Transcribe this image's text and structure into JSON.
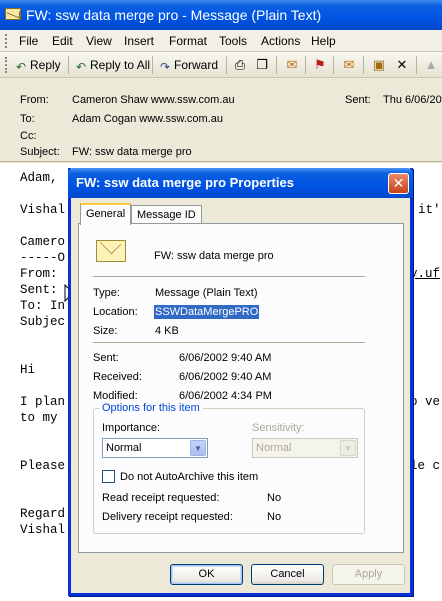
{
  "window": {
    "title": "FW: ssw data merge pro - Message (Plain Text)"
  },
  "menu": {
    "items": [
      "File",
      "Edit",
      "View",
      "Insert",
      "Format",
      "Tools",
      "Actions",
      "Help"
    ]
  },
  "toolbar": {
    "reply": "Reply",
    "reply_all": "Reply to All",
    "forward": "Forward"
  },
  "headers": {
    "from_label": "From:",
    "from_value": "Cameron Shaw  www.ssw.com.au",
    "sent_label": "Sent:",
    "sent_value": "Thu 6/06/20",
    "to_label": "To:",
    "to_value": "Adam Cogan  www.ssw.com.au",
    "cc_label": "Cc:",
    "cc_value": "",
    "subject_label": "Subject:",
    "subject_value": "FW: ssw data merge pro"
  },
  "body": {
    "lines_left": [
      "Adam,",
      "Vishal",
      "Camero",
      "-----O",
      "From:",
      "Sent:",
      "To: In",
      "Subjec",
      "Hi",
      "I plan",
      "to my ",
      "Please",
      "Regard",
      "Vishal"
    ],
    "lines_right": [
      "it'",
      "y.uf",
      "o ve",
      "le c"
    ]
  },
  "dialog": {
    "title": "FW: ssw data merge pro Properties",
    "close": "✕",
    "tabs": [
      "General",
      "Message ID"
    ],
    "item_name": "FW: ssw data merge pro",
    "type_label": "Type:",
    "type_value": "Message  (Plain Text)",
    "location_label": "Location:",
    "location_value": "SSWDataMergePRO",
    "size_label": "Size:",
    "size_value": "4 KB",
    "sent_label": "Sent:",
    "sent_value": "6/06/2002 9:40 AM",
    "received_label": "Received:",
    "received_value": "6/06/2002 9:40 AM",
    "modified_label": "Modified:",
    "modified_value": "6/06/2002 4:34 PM",
    "options_legend": "Options for this item",
    "importance_label": "Importance:",
    "importance_value": "Normal",
    "sensitivity_label": "Sensitivity:",
    "sensitivity_value": "Normal",
    "autoarchive_label": "Do not AutoArchive this item",
    "read_receipt_label": "Read receipt requested:",
    "read_receipt_value": "No",
    "delivery_receipt_label": "Delivery receipt requested:",
    "delivery_receipt_value": "No",
    "ok": "OK",
    "cancel": "Cancel",
    "apply": "Apply"
  }
}
